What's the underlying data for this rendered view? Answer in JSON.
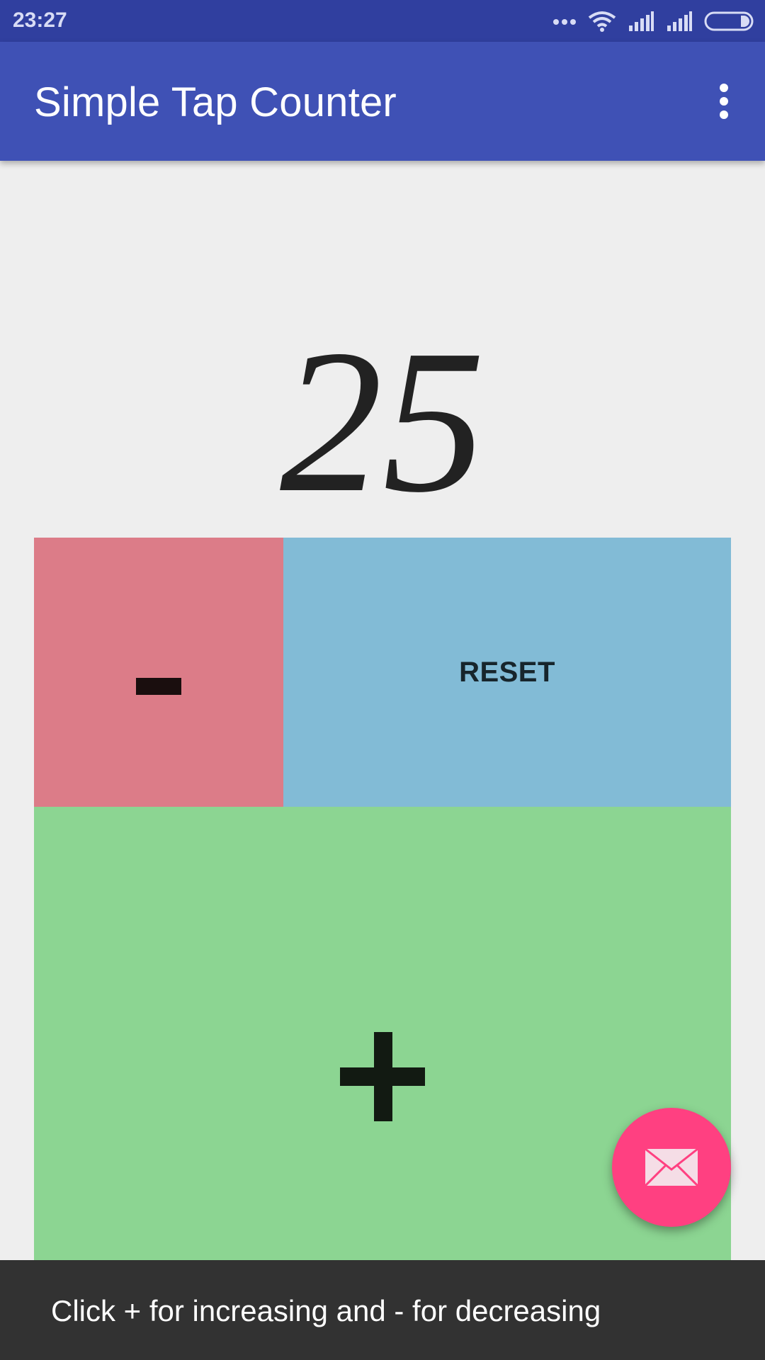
{
  "status_bar": {
    "time": "23:27",
    "icons": [
      "more-dots-icon",
      "wifi-icon",
      "signal-icon",
      "signal-icon",
      "battery-icon"
    ]
  },
  "app_bar": {
    "title": "Simple Tap Counter",
    "menu_icon": "overflow-menu-icon"
  },
  "counter": {
    "value": "25"
  },
  "buttons": {
    "minus_symbol": "-",
    "reset_label": "RESET",
    "plus_symbol": "+"
  },
  "fab": {
    "icon": "email-icon"
  },
  "snackbar": {
    "message": "Click + for increasing and - for decreasing"
  },
  "colors": {
    "status_bar": "#303F9F",
    "app_bar": "#3F51B5",
    "background": "#EEEEEE",
    "minus": "#DC7C88",
    "reset": "#82BBD6",
    "plus": "#8CD592",
    "fab": "#FF4081",
    "snackbar": "#323232"
  }
}
